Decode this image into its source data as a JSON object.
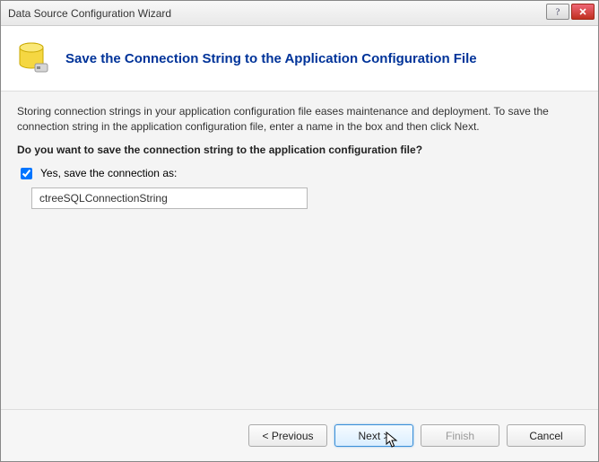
{
  "window": {
    "title": "Data Source Configuration Wizard"
  },
  "header": {
    "title": "Save the Connection String to the Application Configuration File"
  },
  "content": {
    "description": "Storing connection strings in your application configuration file eases maintenance and deployment. To save the connection string in the application configuration file, enter a name in the box and then click Next.",
    "question": "Do you want to save the connection string to the application configuration file?",
    "checkbox_label": "Yes, save the connection as:",
    "connection_name": "ctreeSQLConnectionString",
    "checkbox_checked": true
  },
  "footer": {
    "previous": "< Previous",
    "next": "Next >",
    "finish": "Finish",
    "cancel": "Cancel"
  }
}
